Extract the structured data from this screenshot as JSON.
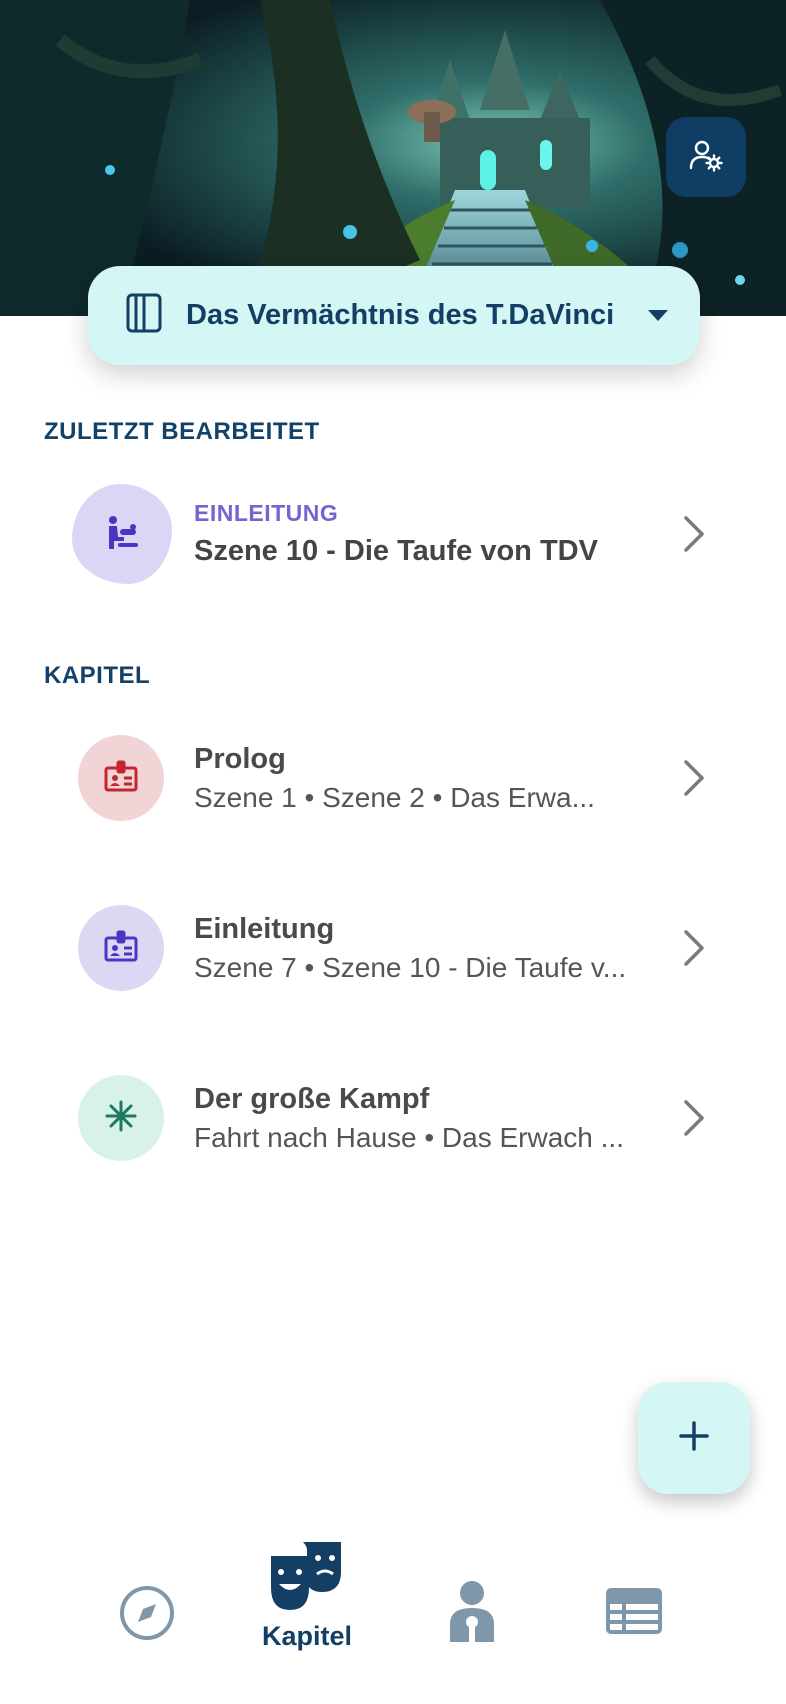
{
  "project": {
    "title": "Das Vermächtnis des T.DaVinci"
  },
  "recent": {
    "heading": "ZULETZT BEARBEITET",
    "item": {
      "chapter": "EINLEITUNG",
      "scene": "Szene 10 - Die Taufe von TDV"
    }
  },
  "chapters": {
    "heading": "KAPITEL",
    "items": [
      {
        "title": "Prolog",
        "scenes": "Szene 1 • Szene 2 • Das Erwa...",
        "color": "#f1d4d6",
        "icon_color": "#c3262f"
      },
      {
        "title": "Einleitung",
        "scenes": "Szene 7 • Szene 10 - Die Taufe v...",
        "color": "#dcd8f4",
        "icon_color": "#4b35c2"
      },
      {
        "title": "Der große Kampf",
        "scenes": "Fahrt nach Hause • Das Erwach ...",
        "color": "#d8f2ea",
        "icon_color": "#1c7a5e"
      }
    ]
  },
  "nav": {
    "active_label": "Kapitel"
  },
  "colors": {
    "brand": "#123f63",
    "accent_bg": "#d4f7f6",
    "recent_overline": "#7a62d0"
  }
}
